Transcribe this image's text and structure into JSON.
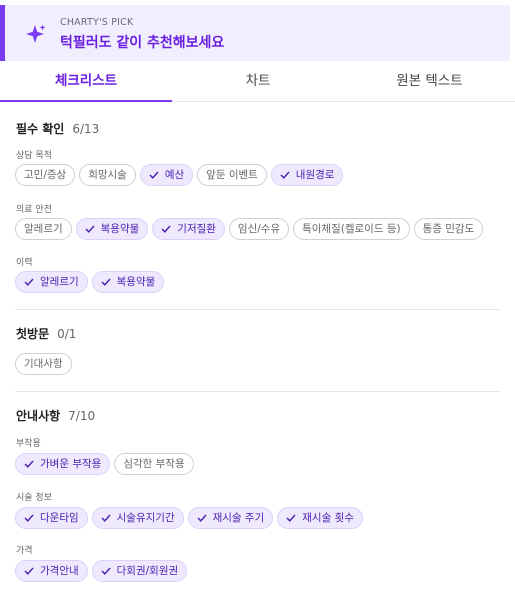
{
  "banner": {
    "kicker": "CHARTY'S PICK",
    "title": "턱필러도 같이 추천해보세요",
    "icon": "sparkle-icon",
    "accent": "#7a3cf0"
  },
  "tabs": [
    {
      "label": "체크리스트",
      "active": true
    },
    {
      "label": "차트",
      "active": false
    },
    {
      "label": "원본 텍스트",
      "active": false
    }
  ],
  "sections": [
    {
      "title": "필수 확인",
      "count": "6/13",
      "groups": [
        {
          "label": "상담 목적",
          "chips": [
            {
              "label": "고민/증상",
              "checked": false
            },
            {
              "label": "희망시술",
              "checked": false
            },
            {
              "label": "예산",
              "checked": true
            },
            {
              "label": "앞둔 이벤트",
              "checked": false
            },
            {
              "label": "내원경로",
              "checked": true
            }
          ]
        },
        {
          "label": "의료 안전",
          "chips": [
            {
              "label": "알레르기",
              "checked": false
            },
            {
              "label": "복용약물",
              "checked": true
            },
            {
              "label": "기저질환",
              "checked": true
            },
            {
              "label": "임신/수유",
              "checked": false
            },
            {
              "label": "특이체질(켈로이드 등)",
              "checked": false
            },
            {
              "label": "통증 민감도",
              "checked": false
            }
          ]
        },
        {
          "label": "이력",
          "chips": [
            {
              "label": "알레르기",
              "checked": true
            },
            {
              "label": "복용약물",
              "checked": true
            }
          ]
        }
      ]
    },
    {
      "title": "첫방문",
      "count": "0/1",
      "groups": [
        {
          "label": "",
          "chips": [
            {
              "label": "기대사항",
              "checked": false
            }
          ]
        }
      ]
    },
    {
      "title": "안내사항",
      "count": "7/10",
      "groups": [
        {
          "label": "부작용",
          "chips": [
            {
              "label": "가벼운 부작용",
              "checked": true
            },
            {
              "label": "심각한 부작용",
              "checked": false
            }
          ]
        },
        {
          "label": "시술 정보",
          "chips": [
            {
              "label": "다운타임",
              "checked": true
            },
            {
              "label": "시술유지기간",
              "checked": true
            },
            {
              "label": "재시술 주기",
              "checked": true
            },
            {
              "label": "재시술 횟수",
              "checked": true
            }
          ]
        },
        {
          "label": "가격",
          "chips": [
            {
              "label": "가격안내",
              "checked": true
            },
            {
              "label": "다회권/회원권",
              "checked": true
            }
          ]
        }
      ]
    }
  ]
}
